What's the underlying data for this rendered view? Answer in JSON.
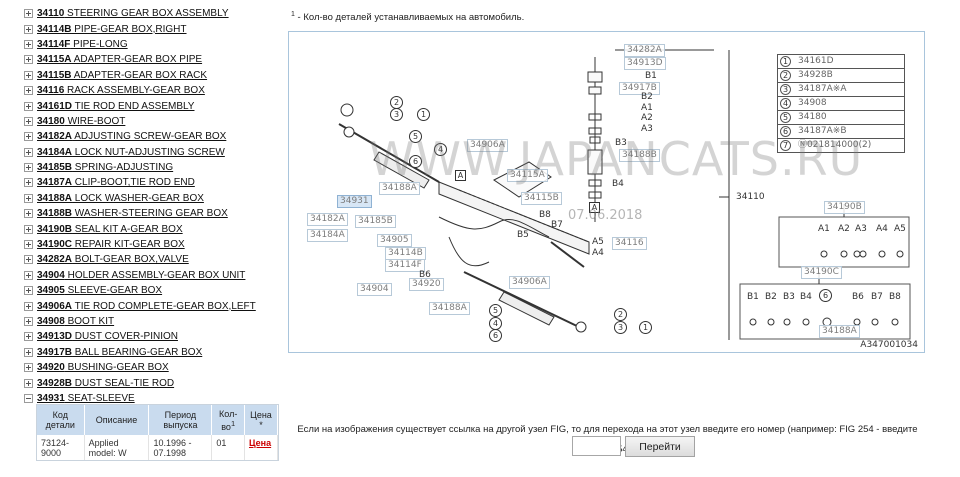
{
  "tree": [
    {
      "code": "34110",
      "name": " STEERING GEAR BOX ASSEMBLY",
      "expanded": false
    },
    {
      "code": "34114B",
      "name": " PIPE-GEAR BOX,RIGHT",
      "expanded": false
    },
    {
      "code": "34114F",
      "name": " PIPE-LONG",
      "expanded": false
    },
    {
      "code": "34115A",
      "name": " ADAPTER-GEAR BOX PIPE",
      "expanded": false
    },
    {
      "code": "34115B",
      "name": " ADAPTER-GEAR BOX RACK",
      "expanded": false
    },
    {
      "code": "34116",
      "name": " RACK ASSEMBLY-GEAR BOX",
      "expanded": false
    },
    {
      "code": "34161D",
      "name": " TIE ROD END ASSEMBLY",
      "expanded": false
    },
    {
      "code": "34180",
      "name": " WIRE-BOOT",
      "expanded": false
    },
    {
      "code": "34182A",
      "name": " ADJUSTING SCREW-GEAR BOX",
      "expanded": false
    },
    {
      "code": "34184A",
      "name": " LOCK NUT-ADJUSTING SCREW",
      "expanded": false
    },
    {
      "code": "34185B",
      "name": " SPRING-ADJUSTING",
      "expanded": false
    },
    {
      "code": "34187A",
      "name": " CLIP-BOOT,TIE ROD END",
      "expanded": false
    },
    {
      "code": "34188A",
      "name": " LOCK WASHER-GEAR BOX",
      "expanded": false
    },
    {
      "code": "34188B",
      "name": " WASHER-STEERING GEAR BOX",
      "expanded": false
    },
    {
      "code": "34190B",
      "name": " SEAL KIT A-GEAR BOX",
      "expanded": false
    },
    {
      "code": "34190C",
      "name": " REPAIR KIT-GEAR BOX",
      "expanded": false
    },
    {
      "code": "34282A",
      "name": " BOLT-GEAR BOX,VALVE",
      "expanded": false
    },
    {
      "code": "34904",
      "name": " HOLDER ASSEMBLY-GEAR BOX UNIT",
      "expanded": false
    },
    {
      "code": "34905",
      "name": " SLEEVE-GEAR BOX",
      "expanded": false
    },
    {
      "code": "34906A",
      "name": " TIE ROD COMPLETE-GEAR BOX,LEFT",
      "expanded": false
    },
    {
      "code": "34908",
      "name": " BOOT KIT",
      "expanded": false
    },
    {
      "code": "34913D",
      "name": " DUST COVER-PINION",
      "expanded": false
    },
    {
      "code": "34917B",
      "name": " BALL BEARING-GEAR BOX",
      "expanded": false
    },
    {
      "code": "34920",
      "name": " BUSHING-GEAR BOX",
      "expanded": false
    },
    {
      "code": "34928B",
      "name": " DUST SEAL-TIE ROD",
      "expanded": false
    },
    {
      "code": "34931",
      "name": " SEAT-SLEEVE",
      "expanded": true
    }
  ],
  "table": {
    "headers": [
      "Код детали",
      "Описание",
      "Период выпуска",
      "Кол-во",
      "Цена *"
    ],
    "header_sup": "1",
    "row": {
      "code": "73124-9000",
      "description": "Applied model: W",
      "period": "10.1996 - 07.1998",
      "qty": "01",
      "price_link": "Цена"
    }
  },
  "footnote": {
    "sup": "1",
    "text": " - Кол-во деталей устанавливаемых на автомобиль."
  },
  "diagram": {
    "watermark": "WWW.JAPANCATS.RU",
    "date": "07.06.2018",
    "code": "A347001034",
    "highlighted_part": "34931",
    "callouts": [
      {
        "id": "c1",
        "text": "34282A"
      },
      {
        "id": "c2",
        "text": "34913D"
      },
      {
        "id": "c3",
        "text": "34917B"
      },
      {
        "id": "c4",
        "text": "34188B"
      },
      {
        "id": "c5",
        "text": "34906A"
      },
      {
        "id": "c6",
        "text": "34188A"
      },
      {
        "id": "c7",
        "text": "34115A"
      },
      {
        "id": "c8",
        "text": "34115B"
      },
      {
        "id": "c9",
        "text": "34931"
      },
      {
        "id": "c10",
        "text": "34182A"
      },
      {
        "id": "c11",
        "text": "34185B"
      },
      {
        "id": "c12",
        "text": "34184A"
      },
      {
        "id": "c13",
        "text": "34905"
      },
      {
        "id": "c14",
        "text": "34114B"
      },
      {
        "id": "c15",
        "text": "34114F"
      },
      {
        "id": "c16",
        "text": "34116"
      },
      {
        "id": "c17",
        "text": "34904"
      },
      {
        "id": "c18",
        "text": "34920"
      },
      {
        "id": "c19",
        "text": "34906A"
      },
      {
        "id": "c20",
        "text": "34188A"
      },
      {
        "id": "c21",
        "text": "34190B"
      },
      {
        "id": "c22",
        "text": "34190C"
      },
      {
        "id": "c23",
        "text": "34188A"
      }
    ],
    "plain_labels": {
      "b1": "B1",
      "b2": "B2",
      "a1": "A1",
      "a2": "A2",
      "a3": "A3",
      "b3": "B3",
      "b4": "B4",
      "b5": "B5",
      "b8": "B8",
      "b7": "B7",
      "a5": "A5",
      "a4": "A4",
      "b6": "B6",
      "main": "34110",
      "k_a1": "A1",
      "k_a2": "A2",
      "k_a3": "A3",
      "k_a4": "A4",
      "k_a5": "A5",
      "k_b1": "B1",
      "k_b2": "B2",
      "k_b3": "B3",
      "k_b4": "B4",
      "k_b6": "B6",
      "k_b7": "B7",
      "k_b8": "B8"
    },
    "legend": [
      {
        "num": "1",
        "value": "34161D"
      },
      {
        "num": "2",
        "value": "34928B"
      },
      {
        "num": "3",
        "value": "34187A※A"
      },
      {
        "num": "4",
        "value": "34908"
      },
      {
        "num": "5",
        "value": "34180"
      },
      {
        "num": "6",
        "value": "34187A※B"
      },
      {
        "num": "7",
        "value": "Ⓝ021814000(2)"
      }
    ]
  },
  "fig": {
    "instruction": "Если на изображения существует ссылка на другой узел FIG, то для перехода на этот узел введите его номер (например: FIG 254 - введите номер 254):",
    "input_value": "",
    "button": "Перейти"
  }
}
